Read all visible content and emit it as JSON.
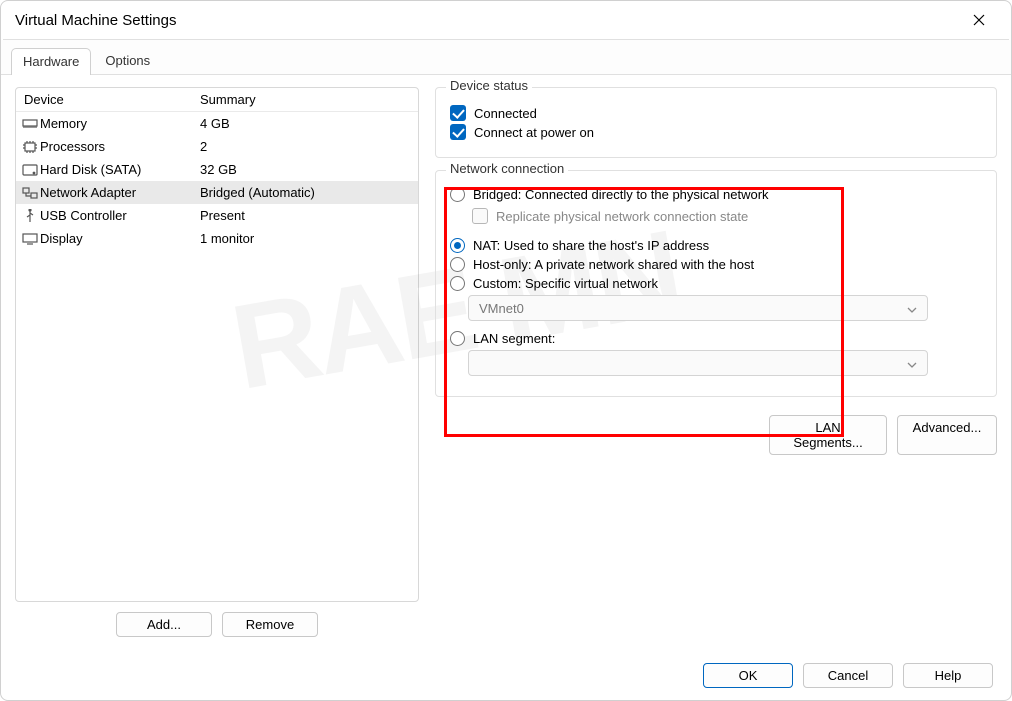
{
  "window": {
    "title": "Virtual Machine Settings"
  },
  "tabs": {
    "hardware": "Hardware",
    "options": "Options"
  },
  "device_headers": {
    "device": "Device",
    "summary": "Summary"
  },
  "devices": [
    {
      "name": "Memory",
      "summary": "4 GB",
      "icon": "memory"
    },
    {
      "name": "Processors",
      "summary": "2",
      "icon": "cpu"
    },
    {
      "name": "Hard Disk (SATA)",
      "summary": "32 GB",
      "icon": "hdd"
    },
    {
      "name": "Network Adapter",
      "summary": "Bridged (Automatic)",
      "icon": "nic",
      "selected": true
    },
    {
      "name": "USB Controller",
      "summary": "Present",
      "icon": "usb"
    },
    {
      "name": "Display",
      "summary": "1 monitor",
      "icon": "display"
    }
  ],
  "left_buttons": {
    "add": "Add...",
    "remove": "Remove"
  },
  "device_status": {
    "legend": "Device status",
    "connected": "Connected",
    "connect_power_on": "Connect at power on"
  },
  "netconn": {
    "legend": "Network connection",
    "bridged": "Bridged: Connected directly to the physical network",
    "replicate": "Replicate physical network connection state",
    "nat": "NAT: Used to share the host's IP address",
    "hostonly": "Host-only: A private network shared with the host",
    "custom": "Custom: Specific virtual network",
    "custom_value": "VMnet0",
    "lanseg": "LAN segment:",
    "lanseg_value": ""
  },
  "right_buttons": {
    "lan": "LAN Segments...",
    "advanced": "Advanced..."
  },
  "footer": {
    "ok": "OK",
    "cancel": "Cancel",
    "help": "Help"
  }
}
